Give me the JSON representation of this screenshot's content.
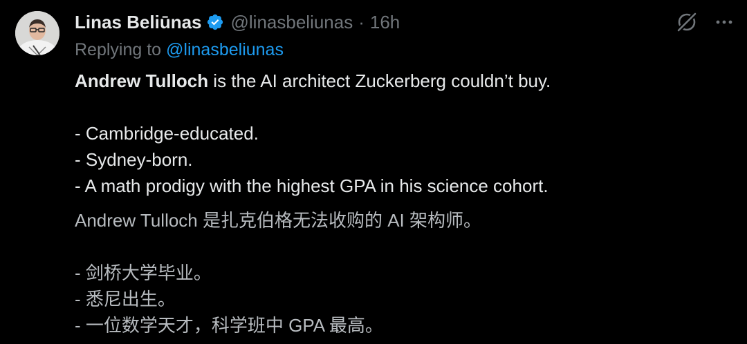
{
  "author": {
    "display_name": "Linas Beliūnas",
    "handle": "@linasbeliunas",
    "separator": "·",
    "timestamp": "16h",
    "avatar_icon": "profile-photo",
    "verified_icon": "verified-badge-icon",
    "verified_color": "#1d9bf0"
  },
  "actions": {
    "grok_icon": "grok-icon",
    "more_icon": "more-icon"
  },
  "reply": {
    "prefix": "Replying to ",
    "mention": "@linasbeliunas"
  },
  "post": {
    "intro_bold": "Andrew Tulloch",
    "intro_rest": " is the AI architect Zuckerberg couldn’t buy.",
    "bullets": [
      "- Cambridge-educated.",
      "- Sydney-born.",
      "- A math prodigy with the highest GPA in his science cohort."
    ]
  },
  "translation": {
    "intro": "Andrew Tulloch 是扎克伯格无法收购的 AI 架构师。",
    "bullets": [
      "- 剑桥大学毕业。",
      "- 悉尼出生。",
      "- 一位数学天才，科学班中 GPA 最高。"
    ]
  },
  "colors": {
    "background": "#000000",
    "text_primary": "#e7e9ea",
    "text_secondary": "#71767b",
    "link": "#1d9bf0"
  }
}
